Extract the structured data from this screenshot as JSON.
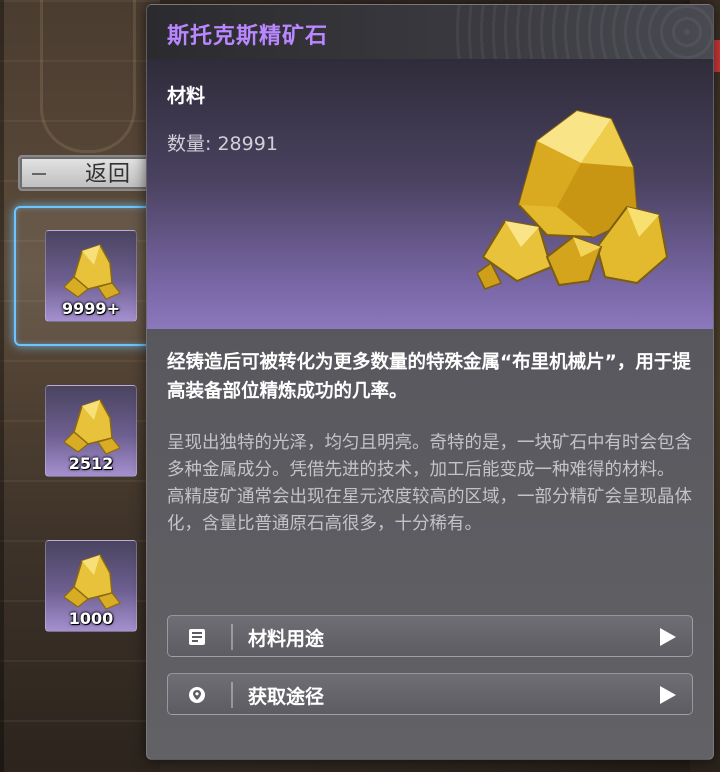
{
  "back_button": {
    "label": "返回"
  },
  "inventory": {
    "slots": [
      {
        "count": "9999+",
        "selected": true
      },
      {
        "count": "2512",
        "selected": false
      },
      {
        "count": "1000",
        "selected": false
      }
    ]
  },
  "detail": {
    "name": "斯托克斯精矿石",
    "name_color": "#b987ff",
    "type": "材料",
    "quantity_label": "数量",
    "quantity_value": "28991",
    "description": "经铸造后可被转化为更多数量的特殊金属“布里机械片”，用于提高装备部位精炼成功的几率。",
    "lore_1": "呈现出独特的光泽，均匀且明亮。奇特的是，一块矿石中有时会包含多种金属成分。凭借先进的技术，加工后能变成一种难得的材料。",
    "lore_2": "高精度矿通常会出现在星元浓度较高的区域，一部分精矿会呈现晶体化，含量比普通原石高很多，十分稀有。",
    "actions": [
      {
        "label": "材料用途",
        "icon": "list-icon"
      },
      {
        "label": "获取途径",
        "icon": "location-pin-icon"
      }
    ]
  },
  "colors": {
    "accent_purple": "#b987ff",
    "gold": "#e8c23a",
    "selection_glow": "#6bc6ff"
  }
}
